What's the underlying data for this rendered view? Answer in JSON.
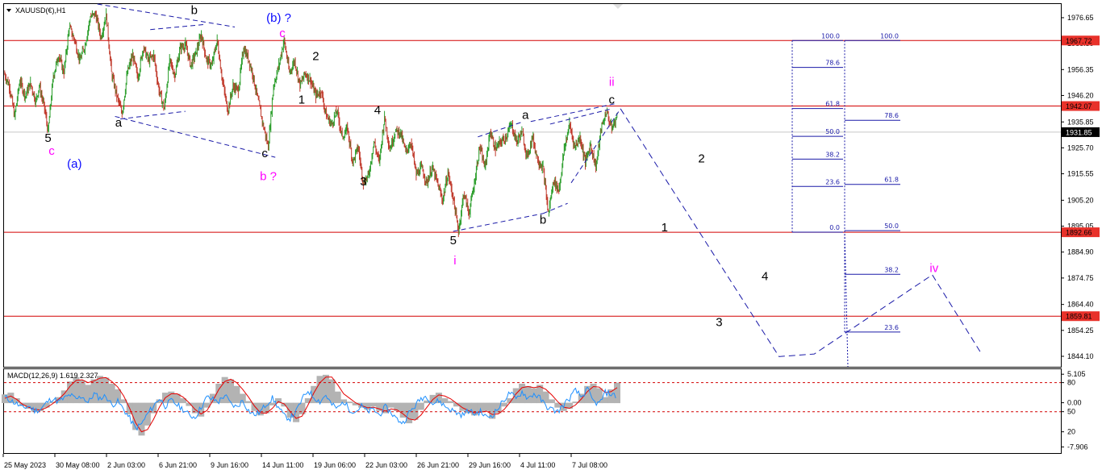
{
  "header": {
    "symbol": "XAUUSD(€),H1",
    "menu_icon": "triangle-down-icon"
  },
  "colors": {
    "background": "#ffffff",
    "candle_up": "#2a9d2a",
    "candle_down": "#c0392b",
    "candle_neutral": "#000000",
    "hline": "#d40000",
    "price_tag_bg": "#e8312a",
    "current_tag_bg": "#000000",
    "wave_blue": "#0a0aff",
    "wave_magenta": "#ff00ff",
    "wave_black": "#000000",
    "fib_blue": "#1a1aa8",
    "macd_hist": "#b3b3b3",
    "macd_signal": "#e60000",
    "macd_line": "#1e90ff",
    "axis_text": "#000000"
  },
  "chart_data": [
    {
      "type": "line",
      "title": "XAUUSD(€),H1",
      "ylim": [
        1840,
        1982
      ],
      "ytick_labels": [
        "1976.65",
        "1966.50",
        "1956.35",
        "1946.20",
        "1935.85",
        "1925.70",
        "1915.55",
        "1905.20",
        "1895.05",
        "1884.90",
        "1874.75",
        "1864.40",
        "1854.25",
        "1844.10"
      ],
      "ytick_values": [
        1976.65,
        1966.5,
        1956.35,
        1946.2,
        1935.85,
        1925.7,
        1915.55,
        1905.2,
        1895.05,
        1884.9,
        1874.75,
        1864.4,
        1854.25,
        1844.1
      ],
      "xtick_labels": [
        "25 May 2023",
        "30 May 08:00",
        "2 Jun 03:00",
        "6 Jun 21:00",
        "9 Jun 16:00",
        "14 Jun 11:00",
        "19 Jun 06:00",
        "22 Jun 03:00",
        "26 Jun 21:00",
        "29 Jun 16:00",
        "4 Jul 11:00",
        "7 Jul 08:00"
      ],
      "price_path": [
        [
          0,
          1955
        ],
        [
          3,
          1950
        ],
        [
          6,
          1938
        ],
        [
          9,
          1952
        ],
        [
          12,
          1946
        ],
        [
          15,
          1951
        ],
        [
          18,
          1944
        ],
        [
          20,
          1950
        ],
        [
          23,
          1941
        ],
        [
          25,
          1932
        ],
        [
          28,
          1954
        ],
        [
          31,
          1962
        ],
        [
          34,
          1955
        ],
        [
          37,
          1973
        ],
        [
          40,
          1968
        ],
        [
          43,
          1960
        ],
        [
          46,
          1966
        ],
        [
          49,
          1977
        ],
        [
          52,
          1978
        ],
        [
          55,
          1969
        ],
        [
          58,
          1978
        ],
        [
          61,
          1955
        ],
        [
          64,
          1946
        ],
        [
          67,
          1939
        ],
        [
          70,
          1955
        ],
        [
          73,
          1962
        ],
        [
          76,
          1953
        ],
        [
          79,
          1965
        ],
        [
          82,
          1960
        ],
        [
          85,
          1962
        ],
        [
          88,
          1948
        ],
        [
          91,
          1941
        ],
        [
          94,
          1960
        ],
        [
          97,
          1954
        ],
        [
          100,
          1965
        ],
        [
          103,
          1966
        ],
        [
          106,
          1958
        ],
        [
          109,
          1963
        ],
        [
          112,
          1970
        ],
        [
          115,
          1960
        ],
        [
          118,
          1958
        ],
        [
          121,
          1968
        ],
        [
          124,
          1952
        ],
        [
          127,
          1940
        ],
        [
          130,
          1950
        ],
        [
          133,
          1948
        ],
        [
          136,
          1965
        ],
        [
          139,
          1960
        ],
        [
          141,
          1955
        ],
        [
          144,
          1945
        ],
        [
          147,
          1935
        ],
        [
          150,
          1926
        ],
        [
          153,
          1950
        ],
        [
          156,
          1958
        ],
        [
          159,
          1968
        ],
        [
          162,
          1955
        ],
        [
          165,
          1960
        ],
        [
          168,
          1950
        ],
        [
          171,
          1955
        ],
        [
          174,
          1952
        ],
        [
          177,
          1946
        ],
        [
          180,
          1948
        ],
        [
          183,
          1938
        ],
        [
          186,
          1935
        ],
        [
          189,
          1940
        ],
        [
          192,
          1930
        ],
        [
          195,
          1933
        ],
        [
          198,
          1920
        ],
        [
          201,
          1926
        ],
        [
          204,
          1912
        ],
        [
          207,
          1915
        ],
        [
          210,
          1928
        ],
        [
          213,
          1920
        ],
        [
          216,
          1938
        ],
        [
          219,
          1925
        ],
        [
          222,
          1932
        ],
        [
          225,
          1932
        ],
        [
          228,
          1924
        ],
        [
          231,
          1928
        ],
        [
          234,
          1915
        ],
        [
          237,
          1918
        ],
        [
          240,
          1912
        ],
        [
          243,
          1918
        ],
        [
          246,
          1912
        ],
        [
          249,
          1905
        ],
        [
          252,
          1916
        ],
        [
          255,
          1906
        ],
        [
          258,
          1893
        ],
        [
          261,
          1908
        ],
        [
          264,
          1900
        ],
        [
          267,
          1912
        ],
        [
          270,
          1926
        ],
        [
          273,
          1918
        ],
        [
          276,
          1932
        ],
        [
          279,
          1925
        ],
        [
          282,
          1928
        ],
        [
          285,
          1930
        ],
        [
          288,
          1935
        ],
        [
          291,
          1928
        ],
        [
          294,
          1932
        ],
        [
          297,
          1922
        ],
        [
          300,
          1930
        ],
        [
          303,
          1921
        ],
        [
          306,
          1918
        ],
        [
          309,
          1900
        ],
        [
          312,
          1913
        ],
        [
          315,
          1909
        ],
        [
          318,
          1925
        ],
        [
          321,
          1935
        ],
        [
          324,
          1926
        ],
        [
          327,
          1930
        ],
        [
          330,
          1920
        ],
        [
          333,
          1927
        ],
        [
          336,
          1918
        ],
        [
          339,
          1933
        ],
        [
          342,
          1940
        ],
        [
          345,
          1933
        ],
        [
          348,
          1938
        ]
      ],
      "horizontal_levels": [
        {
          "value": 1967.72,
          "label": "1967.72"
        },
        {
          "value": 1942.07,
          "label": "1942.07"
        },
        {
          "value": 1892.66,
          "label": "1892.66"
        },
        {
          "value": 1859.81,
          "label": "1859.81"
        }
      ],
      "current_price": {
        "value": 1931.85,
        "label": "1931.85"
      },
      "wave_labels": [
        {
          "text": "5",
          "color": "wave_black",
          "x": 25,
          "y": 1928
        },
        {
          "text": "c",
          "color": "wave_magenta",
          "x": 27,
          "y": 1923
        },
        {
          "text": "(a)",
          "color": "wave_blue",
          "x": 40,
          "y": 1918
        },
        {
          "text": "a",
          "color": "wave_black",
          "x": 65,
          "y": 1934
        },
        {
          "text": "b",
          "color": "wave_black",
          "x": 108,
          "y": 1978
        },
        {
          "text": "(b) ?",
          "color": "wave_blue",
          "x": 156,
          "y": 1975
        },
        {
          "text": "c",
          "color": "wave_magenta",
          "x": 158,
          "y": 1969
        },
        {
          "text": "c",
          "color": "wave_black",
          "x": 148,
          "y": 1922
        },
        {
          "text": "b ?",
          "color": "wave_magenta",
          "x": 150,
          "y": 1913
        },
        {
          "text": "2",
          "color": "wave_black",
          "x": 177,
          "y": 1960
        },
        {
          "text": "1",
          "color": "wave_black",
          "x": 169,
          "y": 1943
        },
        {
          "text": "4",
          "color": "wave_black",
          "x": 212,
          "y": 1939
        },
        {
          "text": "3",
          "color": "wave_black",
          "x": 204,
          "y": 1911
        },
        {
          "text": "a",
          "color": "wave_black",
          "x": 296,
          "y": 1937
        },
        {
          "text": "ii",
          "color": "wave_magenta",
          "x": 345,
          "y": 1950
        },
        {
          "text": "c",
          "color": "wave_black",
          "x": 345,
          "y": 1943
        },
        {
          "text": "b",
          "color": "wave_black",
          "x": 306,
          "y": 1896
        },
        {
          "text": "5",
          "color": "wave_black",
          "x": 255,
          "y": 1888
        },
        {
          "text": "i",
          "color": "wave_magenta",
          "x": 256,
          "y": 1880
        },
        {
          "text": "2",
          "color": "wave_black",
          "x": 396,
          "y": 1920
        },
        {
          "text": "1",
          "color": "wave_black",
          "x": 375,
          "y": 1893
        },
        {
          "text": "4",
          "color": "wave_black",
          "x": 432,
          "y": 1874
        },
        {
          "text": "3",
          "color": "wave_black",
          "x": 406,
          "y": 1856
        },
        {
          "text": "iv",
          "color": "wave_magenta",
          "x": 528,
          "y": 1877
        }
      ],
      "trend_lines": [
        [
          [
            53,
            1982
          ],
          [
            131,
            1973
          ]
        ],
        [
          [
            63,
            1938
          ],
          [
            154,
            1922
          ]
        ],
        [
          [
            83,
            1972
          ],
          [
            114,
            1974
          ]
        ],
        [
          [
            66,
            1937
          ],
          [
            103,
            1940
          ]
        ],
        [
          [
            269,
            1930
          ],
          [
            295,
            1936
          ]
        ],
        [
          [
            299,
            1936
          ],
          [
            347,
            1943
          ]
        ],
        [
          [
            310,
            1935
          ],
          [
            345,
            1941
          ]
        ],
        [
          [
            255,
            1893
          ],
          [
            306,
            1900
          ]
        ],
        [
          [
            306,
            1900
          ],
          [
            320,
            1904
          ]
        ],
        [
          [
            322,
            1912
          ],
          [
            350,
            1941
          ]
        ]
      ],
      "projection_path": [
        [
          350,
          1941
        ],
        [
          440,
          1844
        ],
        [
          460,
          1845
        ],
        [
          527,
          1876
        ],
        [
          555,
          1845
        ]
      ],
      "fib_retracement_1": {
        "levels": [
          {
            "label": "100.0",
            "value": 1967.72
          },
          {
            "label": "78.6",
            "value": 1957.2
          },
          {
            "label": "61.8",
            "value": 1941.1
          },
          {
            "label": "50.0",
            "value": 1930.2
          },
          {
            "label": "38.2",
            "value": 1921.3
          },
          {
            "label": "23.6",
            "value": 1910.6
          },
          {
            "label": "0.0",
            "value": 1892.7
          }
        ]
      },
      "fib_retracement_2": {
        "levels": [
          {
            "label": "100.0",
            "value": 1967.72
          },
          {
            "label": "78.6",
            "value": 1936.5
          },
          {
            "label": "61.8",
            "value": 1911.4
          },
          {
            "label": "50.0",
            "value": 1893.3
          },
          {
            "label": "38.2",
            "value": 1876.2
          },
          {
            "label": "23.6",
            "value": 1853.6
          }
        ]
      }
    },
    {
      "type": "line",
      "title": "MACD(12,26,9) 1.619 2.327",
      "ylim": [
        -9,
        6
      ],
      "ytick_labels": [
        "5.105",
        "80",
        "0.00",
        "50",
        "20",
        "-7.906"
      ],
      "hlines_dashed": [
        3.6,
        -1.6
      ],
      "series": [
        {
          "name": "Histogram",
          "kind": "bar"
        },
        {
          "name": "Signal",
          "kind": "line"
        },
        {
          "name": "MACD",
          "kind": "line"
        }
      ],
      "histogram": [
        1.5,
        1.8,
        0.8,
        -0.5,
        -1.0,
        -1.6,
        -1.4,
        -0.8,
        0.2,
        1.0,
        2.2,
        3.8,
        4.6,
        4.0,
        3.2,
        4.2,
        4.8,
        4.5,
        3.4,
        2.4,
        0.6,
        -2.0,
        -4.8,
        -5.8,
        -4.0,
        -1.8,
        0.6,
        1.8,
        2.0,
        1.6,
        0.8,
        -0.5,
        -1.8,
        -2.4,
        -0.8,
        1.6,
        3.4,
        4.6,
        4.2,
        3.0,
        1.6,
        0.3,
        -1.4,
        -2.2,
        -1.8,
        -0.4,
        0.8,
        -0.6,
        -2.6,
        -3.4,
        -2.0,
        0.8,
        3.0,
        4.8,
        5.0,
        4.2,
        2.0,
        0.6,
        0.2,
        -0.4,
        -0.8,
        -1.2,
        -0.6,
        -1.4,
        -1.8,
        -0.8,
        -1.4,
        -2.6,
        -3.6,
        -3.0,
        -1.2,
        0.4,
        1.4,
        1.8,
        0.8,
        0.3,
        -0.6,
        -1.4,
        -1.8,
        -2.2,
        -1.6,
        -1.4,
        -2.8,
        -1.8,
        -0.6,
        0.8,
        2.6,
        3.4,
        3.0,
        2.6,
        3.2,
        2.0,
        0.6,
        -0.8,
        -1.4,
        -1.0,
        0.2,
        1.6,
        3.0,
        3.4,
        2.6,
        1.0,
        2.4,
        3.6
      ],
      "signal": [
        0.8,
        1.2,
        0.6,
        -0.3,
        -0.8,
        -1.2,
        -1.3,
        -0.9,
        -0.2,
        0.6,
        1.6,
        3.0,
        4.0,
        4.1,
        3.6,
        3.9,
        4.4,
        4.5,
        3.8,
        2.8,
        1.2,
        -1.0,
        -3.6,
        -5.2,
        -4.8,
        -3.0,
        -0.8,
        0.9,
        1.6,
        1.6,
        1.0,
        0.0,
        -1.2,
        -2.0,
        -1.4,
        0.4,
        2.4,
        3.8,
        4.2,
        3.6,
        2.4,
        1.0,
        -0.6,
        -1.8,
        -1.9,
        -1.0,
        0.2,
        -0.2,
        -1.6,
        -2.8,
        -2.4,
        -0.4,
        1.8,
        3.6,
        4.6,
        4.6,
        3.2,
        1.6,
        0.8,
        0.0,
        -0.5,
        -0.9,
        -0.8,
        -1.1,
        -1.5,
        -1.1,
        -1.3,
        -2.0,
        -2.9,
        -3.1,
        -2.2,
        -0.8,
        0.6,
        1.4,
        1.2,
        0.7,
        -0.1,
        -0.9,
        -1.4,
        -1.8,
        -1.7,
        -1.5,
        -2.1,
        -2.0,
        -1.2,
        0.1,
        1.6,
        2.7,
        2.9,
        2.7,
        2.9,
        2.4,
        1.4,
        0.2,
        -0.8,
        -1.0,
        -0.4,
        0.7,
        2.0,
        2.9,
        2.8,
        1.8,
        2.0,
        2.7
      ],
      "macd": [
        1.0,
        0.4,
        -0.2,
        -1.0,
        -0.6,
        -1.4,
        -1.2,
        0.0,
        0.8,
        0.2,
        0.8,
        1.4,
        0.6,
        1.2,
        0.0,
        1.6,
        0.8,
        1.2,
        -0.4,
        0.2,
        -1.2,
        -2.8,
        -4.6,
        -3.8,
        -2.0,
        -0.6,
        0.8,
        -0.6,
        0.4,
        -0.4,
        -1.2,
        -2.2,
        -2.6,
        -0.8,
        1.0,
        0.6,
        0.2,
        1.4,
        -0.2,
        -0.8,
        0.4,
        -1.4,
        -2.2,
        -1.6,
        -0.2,
        0.8,
        -0.8,
        -2.4,
        -2.8,
        -1.6,
        0.6,
        2.2,
        1.0,
        0.2,
        1.4,
        -0.4,
        -1.0,
        0.2,
        -1.2,
        -1.6,
        -0.6,
        -1.6,
        -1.2,
        -2.2,
        -0.8,
        -1.8,
        -3.0,
        -3.6,
        -1.8,
        -0.6,
        0.8,
        1.2,
        -0.2,
        0.4,
        -0.6,
        -1.2,
        -1.8,
        -2.2,
        -1.4,
        -2.0,
        -1.6,
        -2.6,
        -2.2,
        -1.0,
        0.6,
        1.8,
        0.6,
        2.0,
        0.8,
        1.6,
        0.8,
        -0.6,
        -1.2,
        -1.6,
        -0.4,
        0.8,
        2.2,
        1.0,
        2.4,
        0.2,
        -0.2,
        1.8,
        1.6,
        1.0
      ]
    }
  ]
}
